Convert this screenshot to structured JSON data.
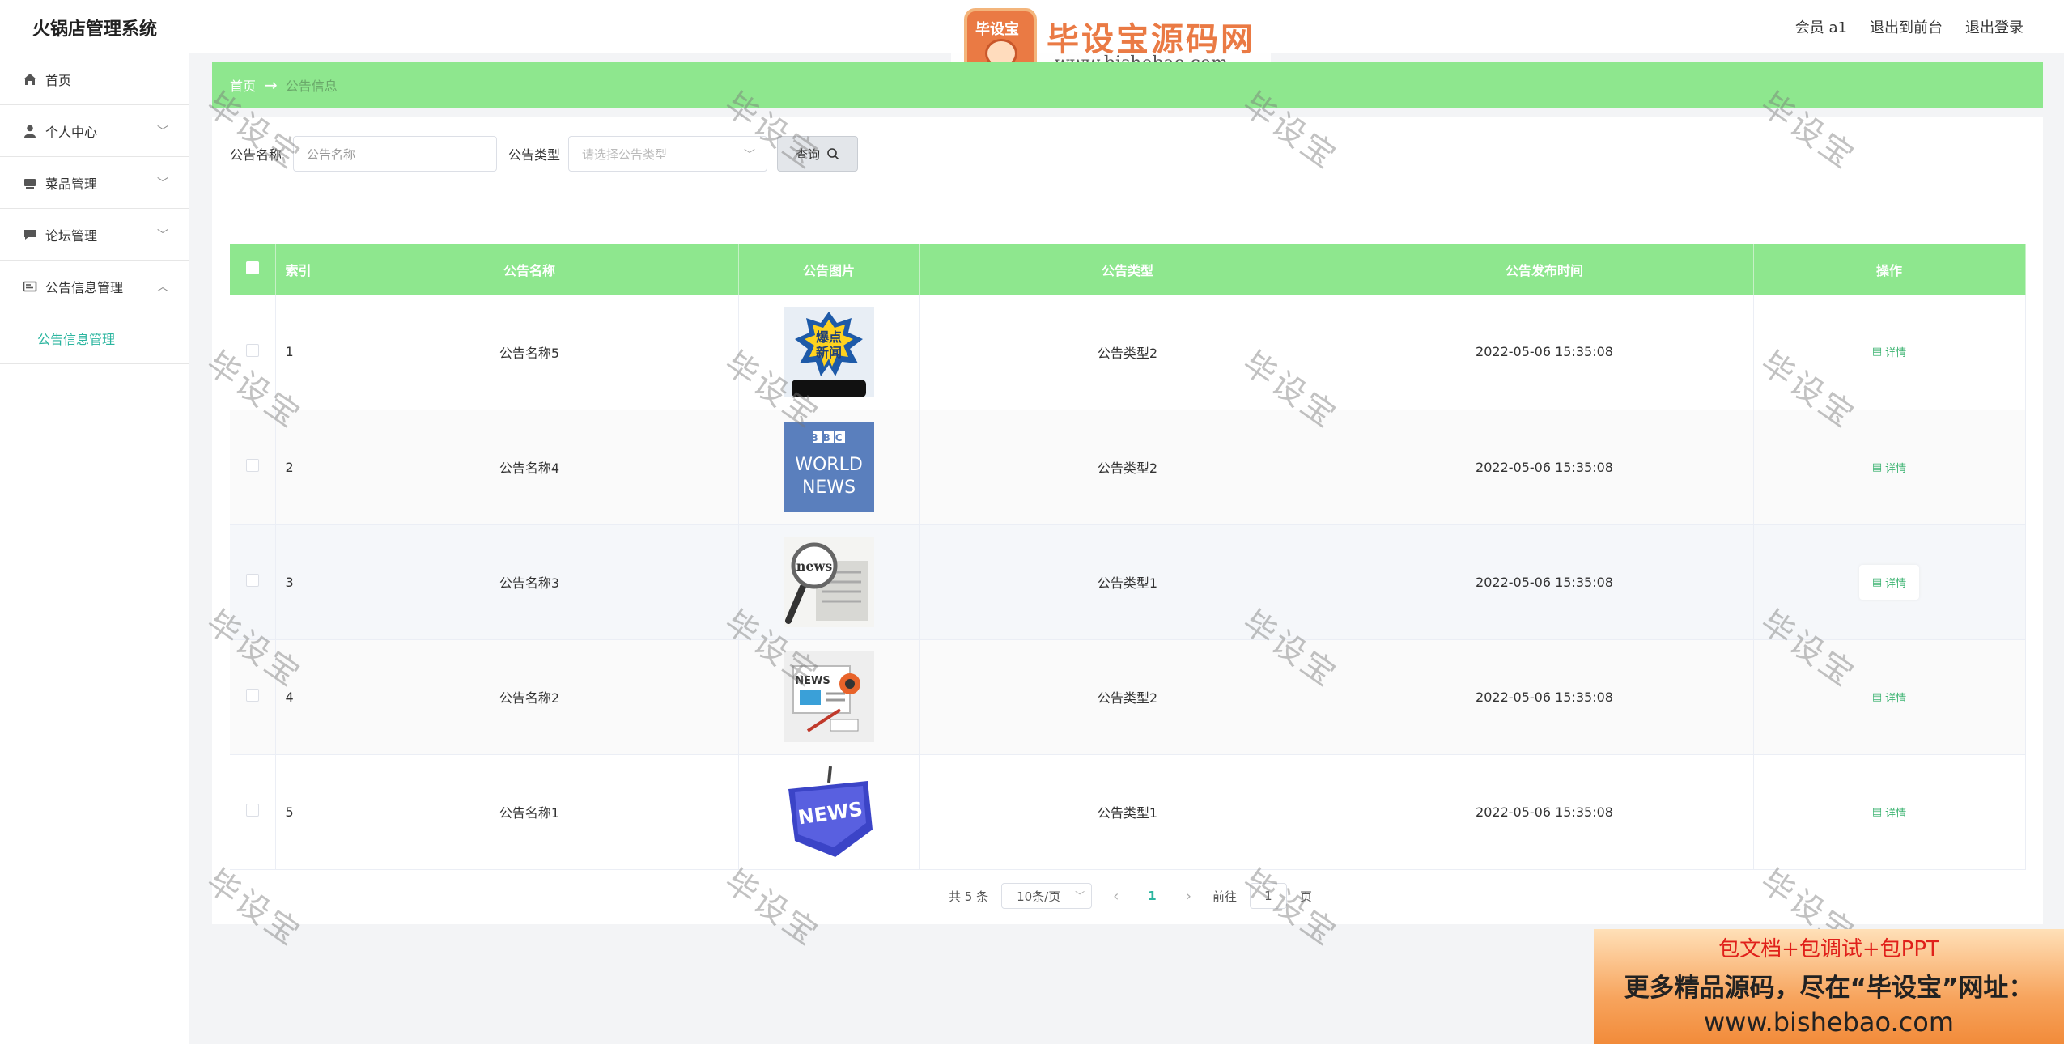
{
  "header": {
    "app_title": "火锅店管理系统",
    "links": [
      "会员 a1",
      "退出到前台",
      "退出登录"
    ]
  },
  "watermark_logo": {
    "badge_text": "毕设宝",
    "brand": "毕设宝源码网",
    "url": "www.bishebao.com"
  },
  "sidebar": {
    "items": [
      {
        "label": "首页",
        "icon": "home-icon"
      },
      {
        "label": "个人中心",
        "icon": "user-icon"
      },
      {
        "label": "菜品管理",
        "icon": "dish-icon"
      },
      {
        "label": "论坛管理",
        "icon": "chat-icon"
      },
      {
        "label": "公告信息管理",
        "icon": "notice-icon"
      }
    ],
    "sub_item": "公告信息管理"
  },
  "breadcrumb": {
    "home": "首页",
    "separator": "→",
    "current": "公告信息"
  },
  "search": {
    "name_label": "公告名称",
    "name_placeholder": "公告名称",
    "type_label": "公告类型",
    "type_placeholder": "请选择公告类型",
    "query_label": "查询"
  },
  "table": {
    "headers": [
      "索引",
      "公告名称",
      "公告图片",
      "公告类型",
      "公告发布时间",
      "操作"
    ],
    "detail_label": "详情",
    "rows": [
      {
        "index": "1",
        "name": "公告名称5",
        "image": "news-image-burst",
        "type": "公告类型2",
        "time": "2022-05-06 15:35:08"
      },
      {
        "index": "2",
        "name": "公告名称4",
        "image": "news-image-bbc",
        "type": "公告类型2",
        "time": "2022-05-06 15:35:08"
      },
      {
        "index": "3",
        "name": "公告名称3",
        "image": "news-image-magnifier",
        "type": "公告类型1",
        "time": "2022-05-06 15:35:08"
      },
      {
        "index": "4",
        "name": "公告名称2",
        "image": "news-image-flat",
        "type": "公告类型2",
        "time": "2022-05-06 15:35:08"
      },
      {
        "index": "5",
        "name": "公告名称1",
        "image": "news-image-key",
        "type": "公告类型1",
        "time": "2022-05-06 15:35:08"
      }
    ],
    "image_text": {
      "burst": [
        "爆点",
        "新闻"
      ],
      "bbc": [
        "BBC",
        "WORLD",
        "NEWS"
      ],
      "magnifier": "news",
      "flat": "NEWS",
      "key": "NEWS"
    }
  },
  "pagination": {
    "total": "共 5 条",
    "page_size": "10条/页",
    "prev": "‹",
    "current_page": "1",
    "next": "›",
    "goto_label": "前往",
    "goto_value": "1",
    "page_suffix": "页"
  },
  "watermark_text": "毕设宝",
  "promo": {
    "line1": "包文档+包调试+包PPT",
    "line2": "更多精品源码，尽在“毕设宝”网址：",
    "line3": "www.bishebao.com"
  },
  "colors": {
    "accent_green": "#8ee78e",
    "teal": "#2bb59f",
    "detail_green": "#3cb371"
  }
}
